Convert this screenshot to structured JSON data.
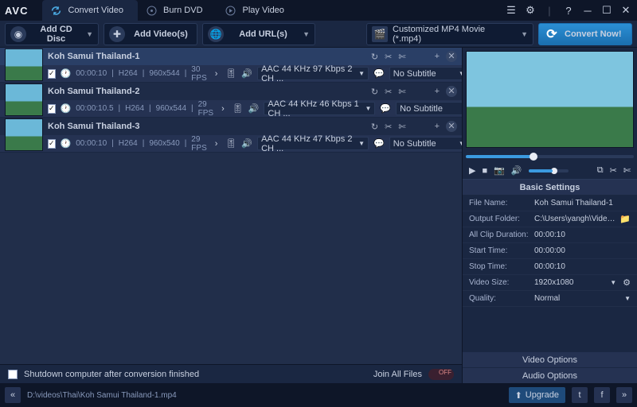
{
  "app": {
    "logo": "AVC"
  },
  "tabs": [
    {
      "label": "Convert Video",
      "active": true,
      "icon": "refresh"
    },
    {
      "label": "Burn DVD",
      "active": false,
      "icon": "disc"
    },
    {
      "label": "Play Video",
      "active": false,
      "icon": "play"
    }
  ],
  "toolbar": {
    "addDisc": "Add CD Disc",
    "addVideo": "Add Video(s)",
    "addUrl": "Add URL(s)",
    "profile": "Customized MP4 Movie (*.mp4)",
    "convert": "Convert Now!"
  },
  "items": [
    {
      "title": "Koh Samui Thailand-1",
      "dur": "00:00:10",
      "vcodec": "H264",
      "res": "960x544",
      "fps": "30 FPS",
      "audio": "AAC 44 KHz 97 Kbps 2 CH ...",
      "sub": "No Subtitle",
      "sel": true
    },
    {
      "title": "Koh Samui Thailand-2",
      "dur": "00:00:10.5",
      "vcodec": "H264",
      "res": "960x544",
      "fps": "29 FPS",
      "audio": "AAC 44 KHz 46 Kbps 1 CH ...",
      "sub": "No Subtitle",
      "sel": false
    },
    {
      "title": "Koh Samui Thailand-3",
      "dur": "00:00:10",
      "vcodec": "H264",
      "res": "960x540",
      "fps": "29 FPS",
      "audio": "AAC 44 KHz 47 Kbps 2 CH ...",
      "sub": "No Subtitle",
      "sel": false
    }
  ],
  "footer": {
    "shutdown": "Shutdown computer after conversion finished",
    "join": "Join All Files"
  },
  "settings": {
    "header": "Basic Settings",
    "rows": {
      "fileName": {
        "k": "File Name:",
        "v": "Koh Samui Thailand-1"
      },
      "output": {
        "k": "Output Folder:",
        "v": "C:\\Users\\yangh\\Videos..."
      },
      "clipDur": {
        "k": "All Clip Duration:",
        "v": "00:00:10"
      },
      "start": {
        "k": "Start Time:",
        "v": "00:00:00"
      },
      "stop": {
        "k": "Stop Time:",
        "v": "00:00:10"
      },
      "size": {
        "k": "Video Size:",
        "v": "1920x1080"
      },
      "quality": {
        "k": "Quality:",
        "v": "Normal"
      }
    },
    "videoOpt": "Video Options",
    "audioOpt": "Audio Options"
  },
  "status": {
    "path": "D:\\videos\\Thai\\Koh Samui Thailand-1.mp4",
    "upgrade": "Upgrade"
  }
}
